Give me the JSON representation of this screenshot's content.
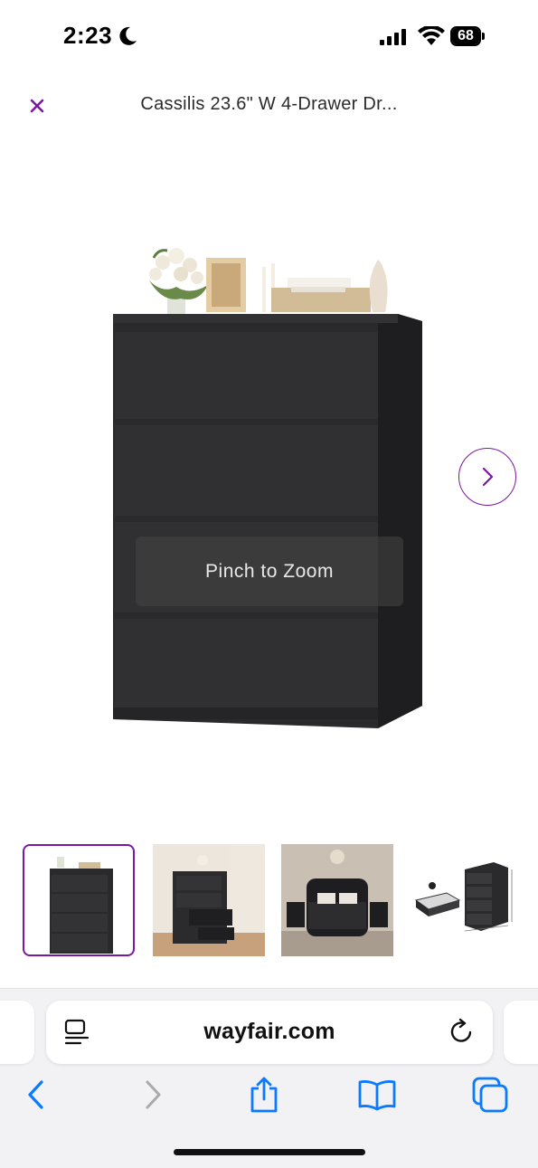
{
  "status_bar": {
    "time": "2:23",
    "battery": "68",
    "icons": [
      "moon-icon",
      "signal-icon",
      "wifi-icon",
      "battery-icon"
    ]
  },
  "header": {
    "close_icon": "close-icon",
    "title": "Cassilis 23.6\" W 4-Drawer Dr..."
  },
  "gallery": {
    "zoom_hint": "Pinch to Zoom",
    "next_icon": "chevron-right-icon",
    "thumbnails": [
      {
        "label": "dresser-front",
        "selected": true
      },
      {
        "label": "dresser-open-drawers-room",
        "selected": false
      },
      {
        "label": "bedroom-scene",
        "selected": false
      },
      {
        "label": "dimensions-diagram",
        "selected": false
      }
    ]
  },
  "browser": {
    "url": "wayfair.com",
    "icons": [
      "reader-icon",
      "reload-icon",
      "back-icon",
      "forward-icon",
      "share-icon",
      "bookmarks-icon",
      "tabs-icon"
    ]
  },
  "colors": {
    "accent": "#7b189f",
    "ios_blue": "#0a7aff",
    "dresser": "#2a2a2c"
  }
}
